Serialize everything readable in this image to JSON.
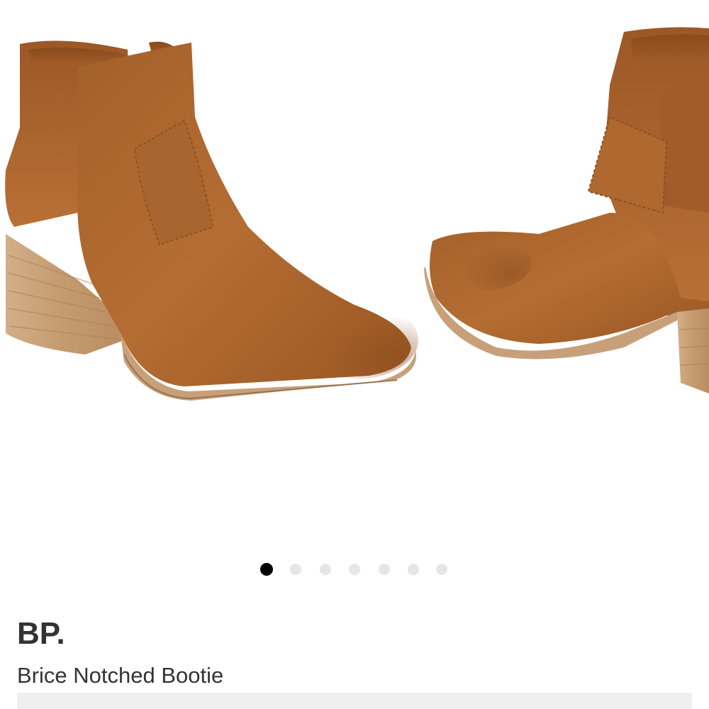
{
  "product": {
    "brand": "BP.",
    "name": "Brice Notched Bootie",
    "image_alt": "Brice Notched Bootie in cognac suede"
  },
  "carousel": {
    "slide_count": 7,
    "active_index": 0,
    "colors": {
      "active_dot": "#000000",
      "inactive_dot": "#e6e6e6",
      "suede": "#b06a2f",
      "heel_wood": "#c9a27a"
    }
  }
}
